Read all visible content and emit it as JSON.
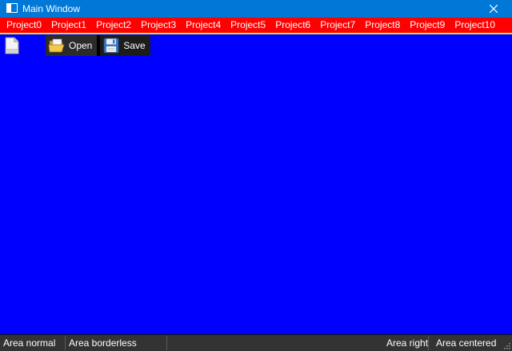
{
  "window": {
    "title": "Main Window",
    "colors": {
      "titlebar": "#0078d7",
      "menubar": "#ff0000",
      "client": "#0000ff",
      "statusbar": "#333333"
    }
  },
  "menu": {
    "items": [
      "Project0",
      "Project1",
      "Project2",
      "Project3",
      "Project4",
      "Project5",
      "Project6",
      "Project7",
      "Project8",
      "Project9",
      "Project10"
    ]
  },
  "toolbar": {
    "new_icon": "document-icon",
    "open_label": "Open",
    "open_icon": "folder-open-icon",
    "save_label": "Save",
    "save_icon": "floppy-disk-icon"
  },
  "status": {
    "normal": "Area normal",
    "borderless": "Area borderless",
    "right": "Area right",
    "centered": "Area centered"
  }
}
